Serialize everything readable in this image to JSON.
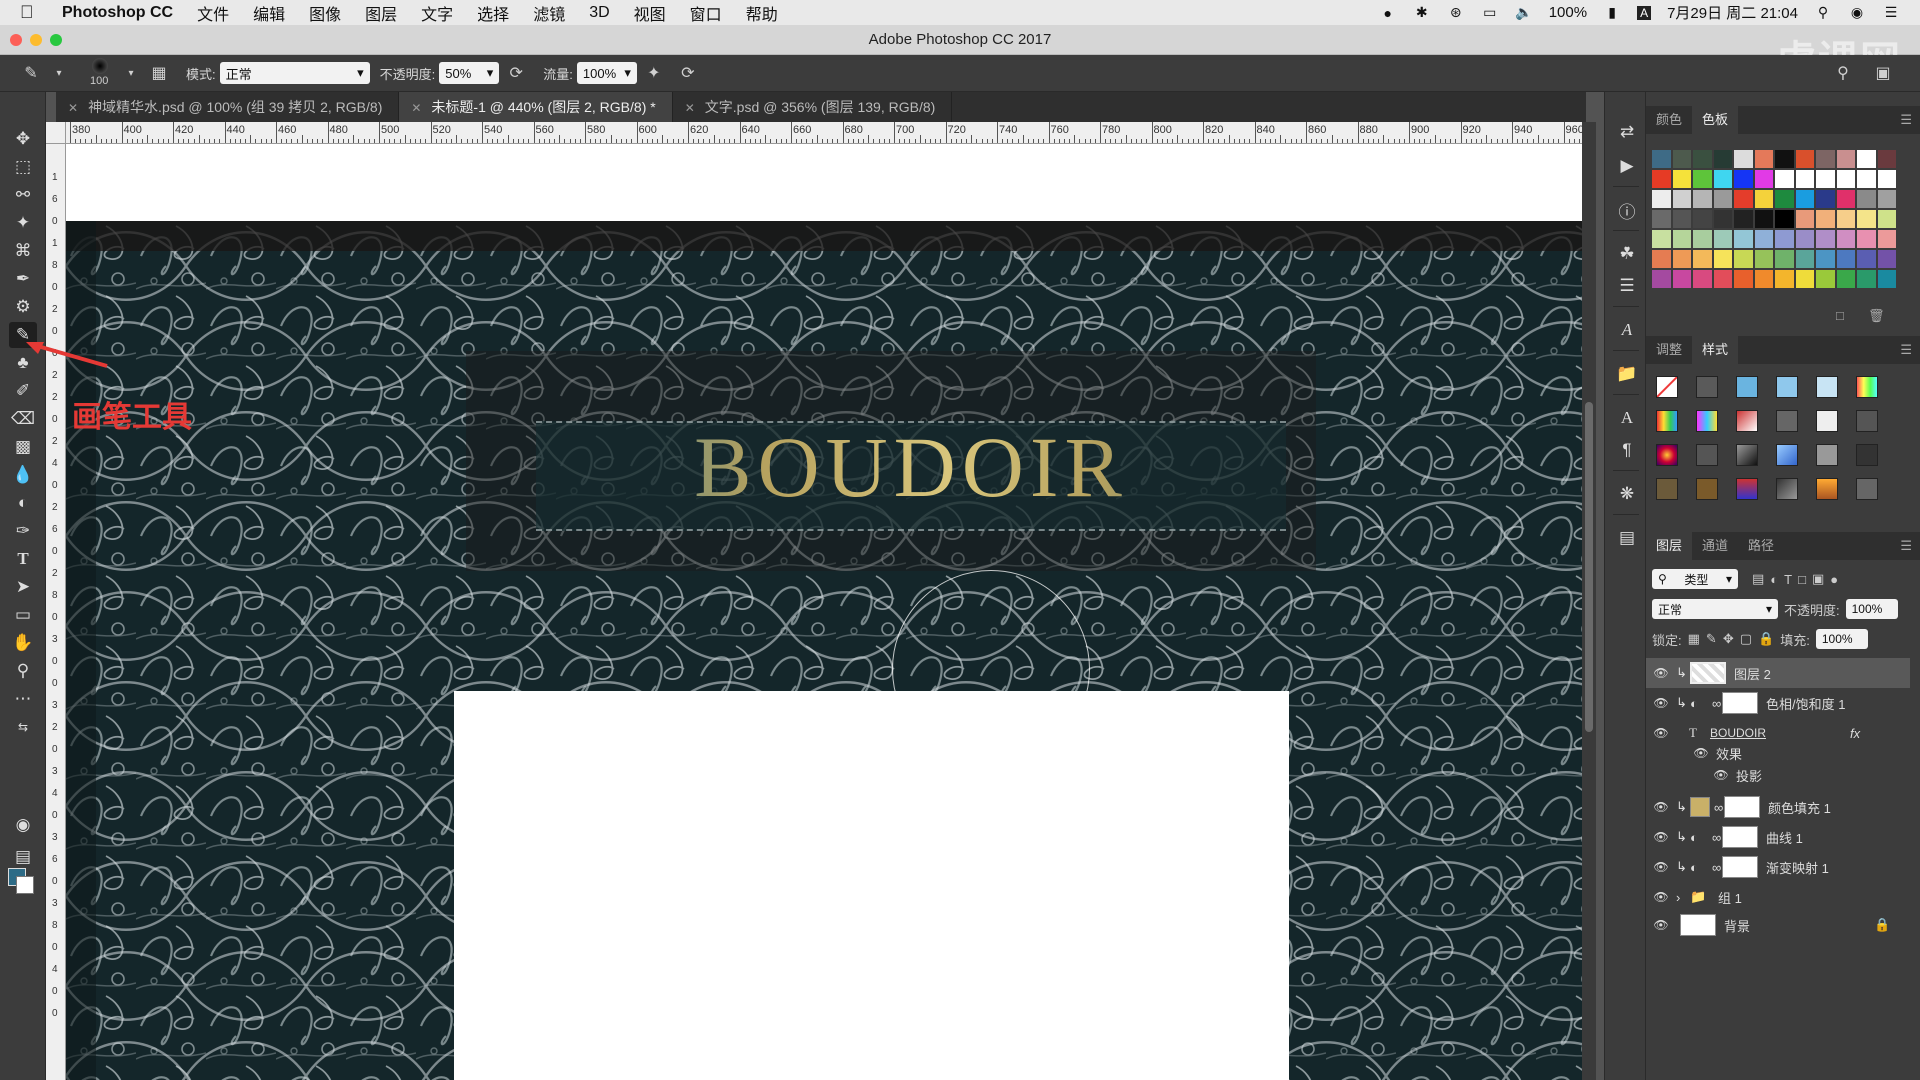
{
  "menubar": {
    "app": "Photoshop CC",
    "items": [
      "文件",
      "编辑",
      "图像",
      "图层",
      "文字",
      "选择",
      "滤镜",
      "3D",
      "视图",
      "窗口",
      "帮助"
    ],
    "battery": "100%",
    "clock": "7月29日 周二 21:04",
    "input_source": "A"
  },
  "window": {
    "title": "Adobe Photoshop CC 2017",
    "watermark": "虎课网"
  },
  "options": {
    "brush_size": "100",
    "mode_label": "模式:",
    "mode_value": "正常",
    "opacity_label": "不透明度:",
    "opacity_value": "50%",
    "flow_label": "流量:",
    "flow_value": "100%"
  },
  "tabs": [
    {
      "label": "神域精华水.psd @ 100% (组 39 拷贝 2, RGB/8)"
    },
    {
      "label": "未标题-1 @ 440% (图层 2, RGB/8) *"
    },
    {
      "label": "文字.psd @ 356% (图层 139, RGB/8)"
    }
  ],
  "ruler_top": [
    "380",
    "400",
    "420",
    "440",
    "460",
    "480",
    "500",
    "520",
    "540",
    "560",
    "580",
    "600",
    "620",
    "640",
    "660",
    "680",
    "700",
    "720",
    "740",
    "760",
    "780",
    "800",
    "820",
    "840",
    "860",
    "880",
    "900",
    "920",
    "940",
    "960"
  ],
  "ruler_left": [
    "1",
    "6",
    "0",
    "1",
    "8",
    "0",
    "2",
    "0",
    "0",
    "2",
    "2",
    "0",
    "2",
    "4",
    "0",
    "2",
    "6",
    "0",
    "2",
    "8",
    "0",
    "3",
    "0",
    "0",
    "3",
    "2",
    "0",
    "3",
    "4",
    "0",
    "3",
    "6",
    "0",
    "3",
    "8",
    "0",
    "4",
    "0",
    "0"
  ],
  "canvas": {
    "title_text": "BOUDOIR"
  },
  "annotation": {
    "text": "画笔工具"
  },
  "colors": {
    "accent_red": "#e53935",
    "foreground": "#2d6b86",
    "doc_bg": "#15272b"
  },
  "swatch_panel": {
    "tabs": [
      "颜色",
      "色板"
    ]
  },
  "style_panel": {
    "tabs": [
      "调整",
      "样式"
    ]
  },
  "layers_panel": {
    "tabs": [
      "图层",
      "通道",
      "路径"
    ],
    "filter_label": "类型",
    "blend_mode": "正常",
    "opacity_label": "不透明度:",
    "opacity_value": "100%",
    "lock_label": "锁定:",
    "fill_label": "填充:",
    "fill_value": "100%",
    "layers": [
      {
        "name": "图层 2"
      },
      {
        "name": "色相/饱和度 1"
      },
      {
        "name": "BOUDOIR",
        "fx": "fx"
      },
      {
        "name": "效果"
      },
      {
        "name": "投影"
      },
      {
        "name": "颜色填充 1"
      },
      {
        "name": "曲线 1"
      },
      {
        "name": "渐变映射 1"
      },
      {
        "name": "组 1"
      },
      {
        "name": "背景"
      }
    ]
  }
}
